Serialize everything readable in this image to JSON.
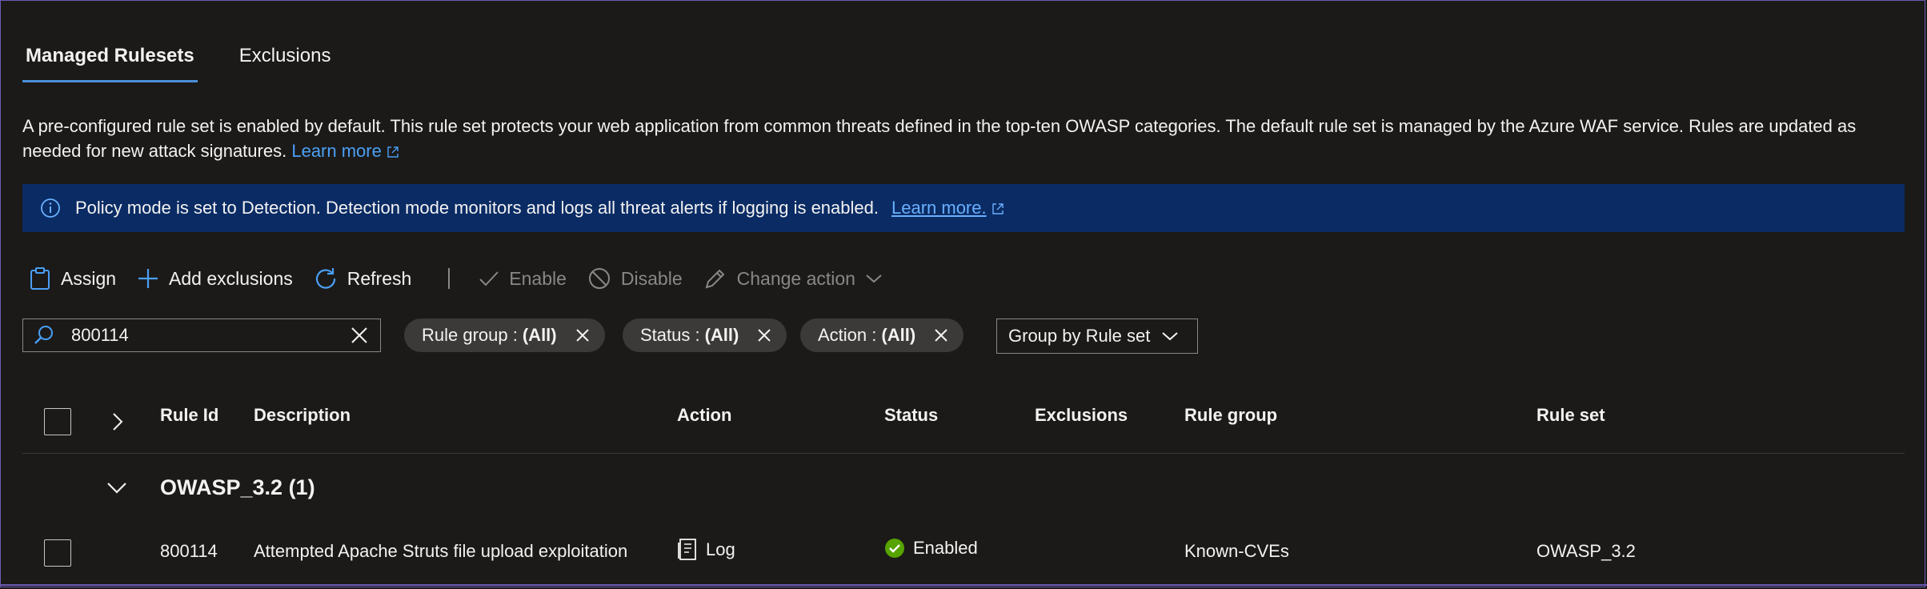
{
  "tabs": [
    {
      "label": "Managed Rulesets",
      "active": true
    },
    {
      "label": "Exclusions",
      "active": false
    }
  ],
  "description": {
    "text": "A pre-configured rule set is enabled by default. This rule set protects your web application from common threats defined in the top-ten OWASP categories. The default rule set is managed by the Azure WAF service. Rules are updated as needed for new attack signatures.",
    "link": "Learn more"
  },
  "banner": {
    "message": "Policy mode is set to Detection. Detection mode monitors and logs all threat alerts if logging is enabled.",
    "link": "Learn more."
  },
  "toolbar": {
    "assign": "Assign",
    "add_exclusions": "Add exclusions",
    "refresh": "Refresh",
    "enable": "Enable",
    "disable": "Disable",
    "change_action": "Change action"
  },
  "search": {
    "value": "800114"
  },
  "filters": {
    "rule_group": {
      "label": "Rule group :",
      "value": "(All)"
    },
    "status": {
      "label": "Status :",
      "value": "(All)"
    },
    "action": {
      "label": "Action :",
      "value": "(All)"
    }
  },
  "group_by": "Group by Rule set",
  "table": {
    "headers": {
      "rule_id": "Rule Id",
      "description": "Description",
      "action": "Action",
      "status": "Status",
      "exclusions": "Exclusions",
      "rule_group": "Rule group",
      "rule_set": "Rule set"
    },
    "group_label": "OWASP_3.2 (1)",
    "rows": [
      {
        "rule_id": "800114",
        "description": "Attempted Apache Struts file upload exploitation",
        "action": "Log",
        "status": "Enabled",
        "rule_group": "Known-CVEs",
        "rule_set": "OWASP_3.2"
      }
    ]
  },
  "colors": {
    "accent": "#4a8fd8",
    "banner_bg": "#0a2b64",
    "link": "#4a9ff5",
    "success": "#57a300"
  }
}
